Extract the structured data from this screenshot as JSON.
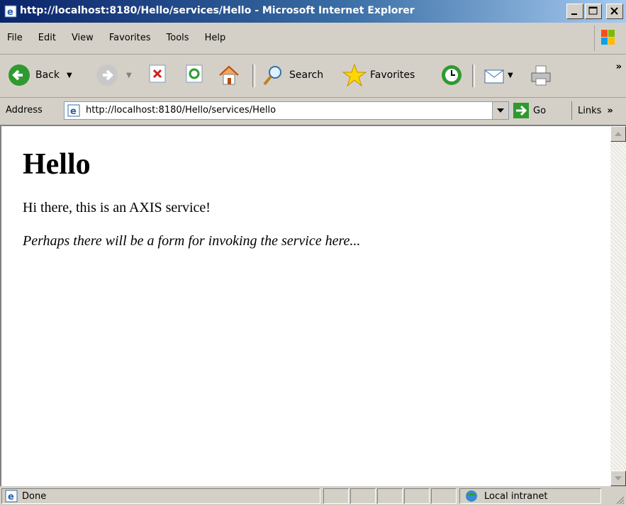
{
  "window": {
    "title": "http://localhost:8180/Hello/services/Hello - Microsoft Internet Explorer"
  },
  "menu": {
    "items": [
      "File",
      "Edit",
      "View",
      "Favorites",
      "Tools",
      "Help"
    ]
  },
  "toolbar": {
    "back_label": "Back",
    "search_label": "Search",
    "favorites_label": "Favorites",
    "more": "»"
  },
  "address": {
    "label": "Address",
    "url": "http://localhost:8180/Hello/services/Hello",
    "go_label": "Go",
    "links_label": "Links",
    "links_more": "»"
  },
  "page": {
    "heading": "Hello",
    "paragraph": "Hi there, this is an AXIS service!",
    "note": "Perhaps there will be a form for invoking the service here..."
  },
  "status": {
    "text": "Done",
    "zone": "Local intranet"
  }
}
